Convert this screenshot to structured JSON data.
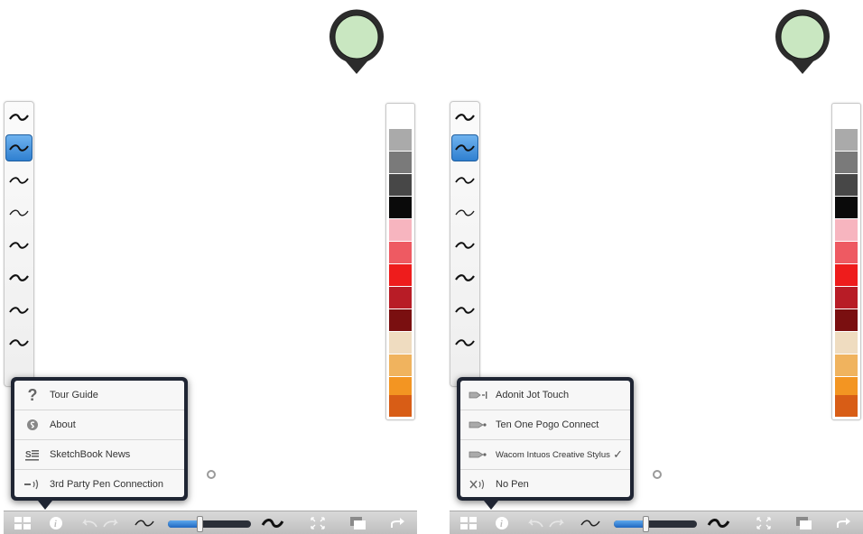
{
  "colors": {
    "puck_fill": "#c9e7c1",
    "puck_ring": "#2c2c2c",
    "menu_frame": "#1f2533",
    "selected_brush": "#2f7fd0",
    "slider_fill": "#3f8ad8"
  },
  "swatch_colors": [
    "#ffffff",
    "#aaaaaa",
    "#7a7a7a",
    "#474747",
    "#0a0a0a",
    "#f7b5bf",
    "#ee5a62",
    "#ee1c1c",
    "#b81c26",
    "#7a0f10",
    "#efdcc0",
    "#f0b35e",
    "#f39522",
    "#d85d16"
  ],
  "brush_icon": "tilde-stroke-icon",
  "left_panel": {
    "menu": [
      {
        "icon": "question-icon",
        "label": "Tour Guide"
      },
      {
        "icon": "sketchbook-logo-icon",
        "label": "About"
      },
      {
        "icon": "news-icon",
        "label": "SketchBook News"
      },
      {
        "icon": "pen-connection-icon",
        "label": "3rd Party Pen Connection"
      }
    ]
  },
  "right_panel": {
    "menu": [
      {
        "icon": "stylus-icon",
        "label": "Adonit Jot Touch",
        "checked": false
      },
      {
        "icon": "stylus-icon",
        "label": "Ten One Pogo Connect",
        "checked": false
      },
      {
        "icon": "stylus-icon",
        "label": "Wacom Intuos Creative Stylus",
        "checked": true
      },
      {
        "icon": "no-pen-icon",
        "label": "No Pen",
        "checked": false
      }
    ]
  },
  "toolbar": {
    "icons": [
      "grid-icon",
      "info-icon",
      "undo-icon",
      "redo-icon",
      "brush-small-icon",
      "brush-large-icon",
      "fullscreen-icon",
      "layers-icon",
      "share-icon"
    ],
    "brush_size_fraction": 0.38
  },
  "check_mark": "✓"
}
